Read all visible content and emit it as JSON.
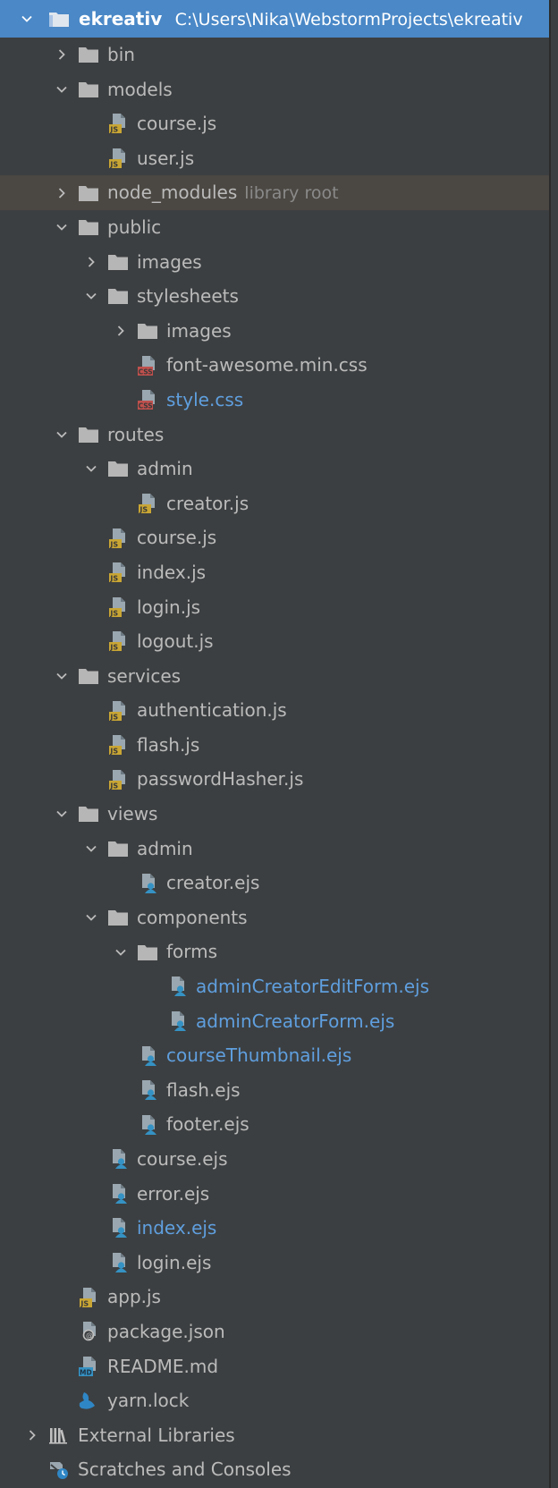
{
  "project": {
    "name": "ekreativ",
    "path": "C:\\Users\\Nika\\WebstormProjects\\ekreativ"
  },
  "colors": {
    "selection": "#4a88c7",
    "background": "#3c3f41",
    "excluded_row": "#4b4742",
    "modified_text": "#5f9fdf",
    "js_badge": "#c9a634",
    "css_badge": "#c0504d",
    "md_badge": "#3592c4",
    "folder": "#b6b6b6"
  },
  "tree": [
    {
      "label": "bin",
      "icon": "folder-icon",
      "level": 1,
      "state": "collapsed"
    },
    {
      "label": "models",
      "icon": "folder-icon",
      "level": 1,
      "state": "expanded"
    },
    {
      "label": "course.js",
      "icon": "js-file-icon",
      "level": 2
    },
    {
      "label": "user.js",
      "icon": "js-file-icon",
      "level": 2
    },
    {
      "label": "node_modules",
      "icon": "folder-icon",
      "level": 1,
      "state": "collapsed",
      "hint": "library root",
      "excluded": true
    },
    {
      "label": "public",
      "icon": "folder-icon",
      "level": 1,
      "state": "expanded"
    },
    {
      "label": "images",
      "icon": "folder-icon",
      "level": 2,
      "state": "collapsed"
    },
    {
      "label": "stylesheets",
      "icon": "folder-icon",
      "level": 2,
      "state": "expanded"
    },
    {
      "label": "images",
      "icon": "folder-icon",
      "level": 3,
      "state": "collapsed"
    },
    {
      "label": "font-awesome.min.css",
      "icon": "css-file-icon",
      "level": 3
    },
    {
      "label": "style.css",
      "icon": "css-file-icon",
      "level": 3,
      "modified": true
    },
    {
      "label": "routes",
      "icon": "folder-icon",
      "level": 1,
      "state": "expanded"
    },
    {
      "label": "admin",
      "icon": "folder-icon",
      "level": 2,
      "state": "expanded"
    },
    {
      "label": "creator.js",
      "icon": "js-file-icon",
      "level": 3
    },
    {
      "label": "course.js",
      "icon": "js-file-icon",
      "level": 2
    },
    {
      "label": "index.js",
      "icon": "js-file-icon",
      "level": 2
    },
    {
      "label": "login.js",
      "icon": "js-file-icon",
      "level": 2
    },
    {
      "label": "logout.js",
      "icon": "js-file-icon",
      "level": 2
    },
    {
      "label": "services",
      "icon": "folder-icon",
      "level": 1,
      "state": "expanded"
    },
    {
      "label": "authentication.js",
      "icon": "js-file-icon",
      "level": 2
    },
    {
      "label": "flash.js",
      "icon": "js-file-icon",
      "level": 2
    },
    {
      "label": "passwordHasher.js",
      "icon": "js-file-icon",
      "level": 2
    },
    {
      "label": "views",
      "icon": "folder-icon",
      "level": 1,
      "state": "expanded"
    },
    {
      "label": "admin",
      "icon": "folder-icon",
      "level": 2,
      "state": "expanded"
    },
    {
      "label": "creator.ejs",
      "icon": "ejs-file-icon",
      "level": 3
    },
    {
      "label": "components",
      "icon": "folder-icon",
      "level": 2,
      "state": "expanded"
    },
    {
      "label": "forms",
      "icon": "folder-icon",
      "level": 3,
      "state": "expanded"
    },
    {
      "label": "adminCreatorEditForm.ejs",
      "icon": "ejs-file-icon",
      "level": 4,
      "modified": true
    },
    {
      "label": "adminCreatorForm.ejs",
      "icon": "ejs-file-icon",
      "level": 4,
      "modified": true
    },
    {
      "label": "courseThumbnail.ejs",
      "icon": "ejs-file-icon",
      "level": 3,
      "modified": true
    },
    {
      "label": "flash.ejs",
      "icon": "ejs-file-icon",
      "level": 3
    },
    {
      "label": "footer.ejs",
      "icon": "ejs-file-icon",
      "level": 3
    },
    {
      "label": "course.ejs",
      "icon": "ejs-file-icon",
      "level": 2
    },
    {
      "label": "error.ejs",
      "icon": "ejs-file-icon",
      "level": 2
    },
    {
      "label": "index.ejs",
      "icon": "ejs-file-icon",
      "level": 2,
      "modified": true
    },
    {
      "label": "login.ejs",
      "icon": "ejs-file-icon",
      "level": 2
    },
    {
      "label": "app.js",
      "icon": "js-file-icon",
      "level": 1
    },
    {
      "label": "package.json",
      "icon": "json-file-icon",
      "level": 1
    },
    {
      "label": "README.md",
      "icon": "md-file-icon",
      "level": 1
    },
    {
      "label": "yarn.lock",
      "icon": "yarn-file-icon",
      "level": 1
    }
  ],
  "footer_items": [
    {
      "label": "External Libraries",
      "icon": "library-icon",
      "state": "collapsed"
    },
    {
      "label": "Scratches and Consoles",
      "icon": "scratches-icon"
    }
  ]
}
